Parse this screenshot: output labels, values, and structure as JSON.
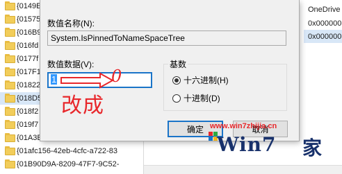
{
  "tree": {
    "items": [
      {
        "label": "{0149E"
      },
      {
        "label": "{01575"
      },
      {
        "label": "{016B9"
      },
      {
        "label": "{016fd"
      },
      {
        "label": "{0177f"
      },
      {
        "label": "{017F1"
      },
      {
        "label": "{01822"
      },
      {
        "label": "{018D5",
        "selected": true
      },
      {
        "label": "{018f2"
      },
      {
        "label": "{019f7"
      },
      {
        "label": "{01A3E"
      },
      {
        "label": "{01afc156-42eb-4cfc-a722-83"
      },
      {
        "label": "{01B90D9A-8209-47F7-9C52-"
      }
    ]
  },
  "values_pane": {
    "row1": "OneDrive",
    "row2": "0x000000",
    "row3": "0x000000"
  },
  "dialog": {
    "value_name_label": "数值名称(N):",
    "value_name": "System.IsPinnedToNameSpaceTree",
    "value_data_label": "数值数据(V):",
    "value_data": "1",
    "base_label": "基数",
    "radio_hex": "十六进制(H)",
    "radio_dec": "十进制(D)",
    "ok_label": "确定",
    "cancel_label": "取消"
  },
  "annotation": {
    "zero": "0",
    "change_text": "改成"
  },
  "watermark": {
    "url": "www.win7zhijia.cn",
    "brand": "Win7",
    "char": "家"
  },
  "colors": {
    "accent": "#1a74c8",
    "annotation_red": "#e8272b",
    "folder": "#f2cd5a"
  }
}
